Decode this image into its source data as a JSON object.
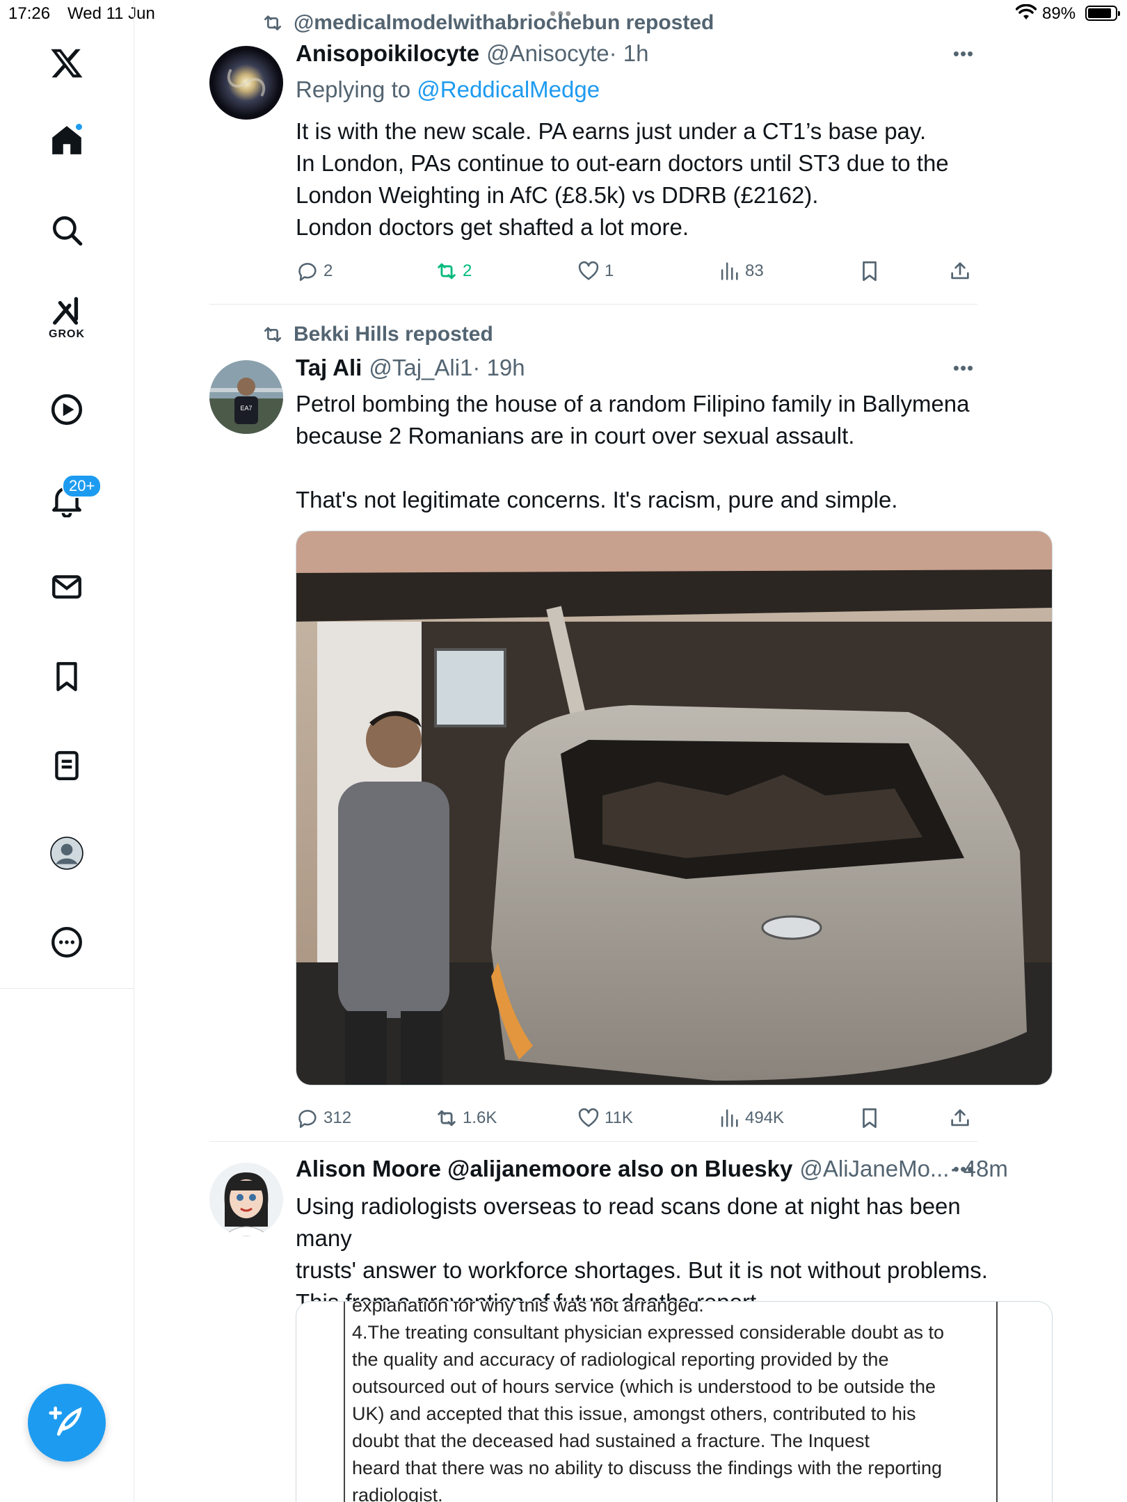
{
  "status_bar": {
    "time": "17:26",
    "date": "Wed 11 Jun",
    "battery": "89%"
  },
  "sidebar": {
    "grok_label": "GROK",
    "notifications_badge": "20+"
  },
  "tweets": [
    {
      "repost_label": "@medicalmodelwithabriochebun reposted",
      "name": "Anisopoikilocyte",
      "handle": "@Anisocyte",
      "time": "· 1h",
      "replying_prefix": "Replying to ",
      "replying_handle": "@ReddicalMedge",
      "lines": [
        "It is with the new scale. PA earns just under a CT1’s base pay.",
        "In London, PAs continue to out-earn doctors until ST3 due to the",
        "London Weighting in AfC (£8.5k) vs DDRB (£2162).",
        "London doctors get shafted a lot more."
      ],
      "replies": "2",
      "reposts": "2",
      "likes": "1",
      "views": "83"
    },
    {
      "repost_label": "Bekki Hills reposted",
      "name": "Taj Ali",
      "handle": "@Taj_Ali1",
      "time": "· 19h",
      "lines": [
        "Petrol bombing the house of a random Filipino family in Ballymena",
        "because 2 Romanians are in court over sexual assault.",
        "",
        "That's not legitimate concerns. It's racism, pure and simple."
      ],
      "replies": "312",
      "reposts": "1.6K",
      "likes": "11K",
      "views": "494K"
    },
    {
      "name": "Alison Moore @alijanemoore also on Bluesky",
      "handle": "@AliJaneMo...",
      "time": "· 48m",
      "lines": [
        "Using radiologists overseas to read scans done at night has been many",
        "trusts' answer to workforce shortages. But it is not without problems.",
        "This from a prevention of future deaths report."
      ],
      "doc_lines": [
        "explanation for why this was not arranged.",
        "4.The treating consultant physician expressed considerable doubt as to",
        "the quality and  accuracy of radiological reporting provided by the",
        "outsourced out of hours service (which is understood to be outside the",
        "UK)  and accepted that this issue, amongst others,  contributed to his",
        "doubt that the deceased had sustained a fracture. The Inquest",
        "heard that there was no ability to discuss the findings with the reporting",
        "radiologist."
      ]
    }
  ]
}
